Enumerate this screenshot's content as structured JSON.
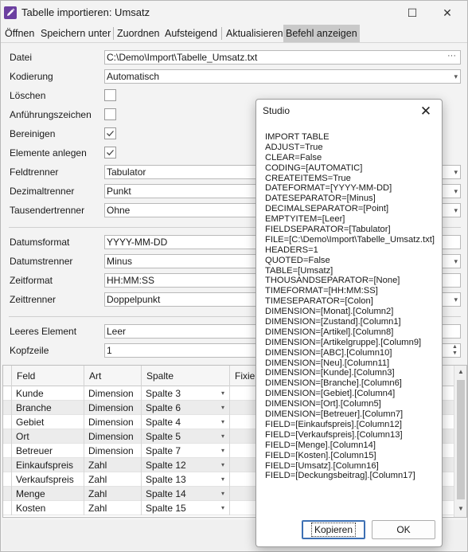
{
  "window": {
    "title": "Tabelle importieren: Umsatz",
    "maximize_glyph": "☐",
    "close_glyph": "✕"
  },
  "menu": [
    "Öffnen",
    "Speichern unter",
    "Zuordnen",
    "Aufsteigend",
    "Aktualisieren",
    "Befehl anzeigen"
  ],
  "form": {
    "datei_label": "Datei",
    "datei_value": "C:\\Demo\\Import\\Tabelle_Umsatz.txt",
    "kodierung_label": "Kodierung",
    "kodierung_value": "Automatisch",
    "loeschen_label": "Löschen",
    "loeschen_checked": false,
    "anfuehrung_label": "Anführungszeichen",
    "anfuehrung_checked": false,
    "bereinigen_label": "Bereinigen",
    "bereinigen_checked": true,
    "elemente_label": "Elemente anlegen",
    "elemente_checked": true,
    "feldtrenner_label": "Feldtrenner",
    "feldtrenner_value": "Tabulator",
    "dezimal_label": "Dezimaltrenner",
    "dezimal_value": "Punkt",
    "tausender_label": "Tausendertrenner",
    "tausender_value": "Ohne",
    "datumsformat_label": "Datumsformat",
    "datumsformat_value": "YYYY-MM-DD",
    "datumstrenner_label": "Datumstrenner",
    "datumstrenner_value": "Minus",
    "zeitformat_label": "Zeitformat",
    "zeitformat_value": "HH:MM:SS",
    "zeittrenner_label": "Zeittrenner",
    "zeittrenner_value": "Doppelpunkt",
    "leer_label": "Leeres Element",
    "leer_value": "Leer",
    "kopfzeile_label": "Kopfzeile",
    "kopfzeile_value": "1"
  },
  "grid": {
    "columns": [
      "Feld",
      "Art",
      "Spalte",
      "Fixier"
    ],
    "rows": [
      {
        "feld": "Kunde",
        "art": "Dimension",
        "spalte": "Spalte 3"
      },
      {
        "feld": "Branche",
        "art": "Dimension",
        "spalte": "Spalte 6"
      },
      {
        "feld": "Gebiet",
        "art": "Dimension",
        "spalte": "Spalte 4"
      },
      {
        "feld": "Ort",
        "art": "Dimension",
        "spalte": "Spalte 5"
      },
      {
        "feld": "Betreuer",
        "art": "Dimension",
        "spalte": "Spalte 7"
      },
      {
        "feld": "Einkaufspreis",
        "art": "Zahl",
        "spalte": "Spalte 12"
      },
      {
        "feld": "Verkaufspreis",
        "art": "Zahl",
        "spalte": "Spalte 13"
      },
      {
        "feld": "Menge",
        "art": "Zahl",
        "spalte": "Spalte 14"
      },
      {
        "feld": "Kosten",
        "art": "Zahl",
        "spalte": "Spalte 15"
      }
    ]
  },
  "dialog": {
    "title": "Studio",
    "close_glyph": "✕",
    "command_lines": [
      "IMPORT TABLE",
      "ADJUST=True",
      "CLEAR=False",
      "CODING=[AUTOMATIC]",
      "CREATEITEMS=True",
      "DATEFORMAT=[YYYY-MM-DD]",
      "DATESEPARATOR=[Minus]",
      "DECIMALSEPARATOR=[Point]",
      "EMPTYITEM=[Leer]",
      "FIELDSEPARATOR=[Tabulator]",
      "FILE=[C:\\Demo\\Import\\Tabelle_Umsatz.txt]",
      "HEADERS=1",
      "QUOTED=False",
      "TABLE=[Umsatz]",
      "THOUSANDSEPARATOR=[None]",
      "TIMEFORMAT=[HH:MM:SS]",
      "TIMESEPARATOR=[Colon]",
      "DIMENSION=[Monat].[Column2]",
      "DIMENSION=[Zustand].[Column1]",
      "DIMENSION=[Artikel].[Column8]",
      "DIMENSION=[Artikelgruppe].[Column9]",
      "DIMENSION=[ABC].[Column10]",
      "DIMENSION=[Neu].[Column11]",
      "DIMENSION=[Kunde].[Column3]",
      "DIMENSION=[Branche].[Column6]",
      "DIMENSION=[Gebiet].[Column4]",
      "DIMENSION=[Ort].[Column5]",
      "DIMENSION=[Betreuer].[Column7]",
      "FIELD=[Einkaufspreis].[Column12]",
      "FIELD=[Verkaufspreis].[Column13]",
      "FIELD=[Menge].[Column14]",
      "FIELD=[Kosten].[Column15]",
      "FIELD=[Umsatz].[Column16]",
      "FIELD=[Deckungsbeitrag].[Column17]"
    ],
    "copy_label": "Kopieren",
    "ok_label": "OK"
  },
  "icons": {
    "app": "edit-pencil-icon",
    "dropdown": "▾",
    "ellipsis": "···",
    "spin_up": "▲",
    "spin_down": "▼",
    "scroll_up": "▲",
    "scroll_down": "▼"
  },
  "colors": {
    "app_icon": "#6b3fa0",
    "active_menu": "#c9c9c9",
    "dialog_default_border": "#3c6fb3"
  }
}
